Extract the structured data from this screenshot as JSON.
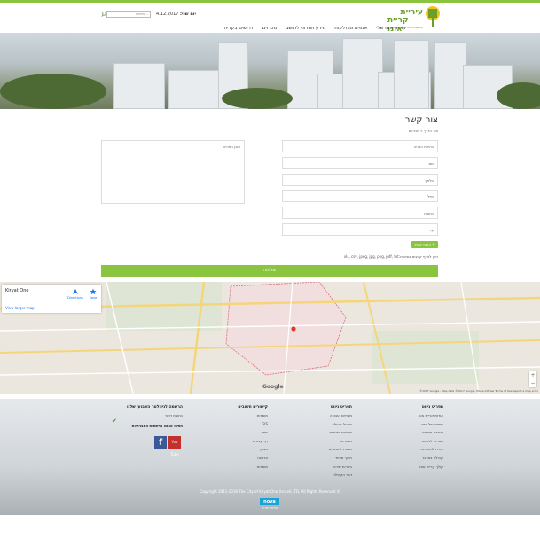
{
  "header": {
    "logo_line1": "עיריית",
    "logo_line2": "קריית אונו",
    "logo_sub": "Kiryat Ono Municipality",
    "date_label": "יום שני:",
    "date_value": "4.12.2017",
    "search_placeholder": "חיפוש..."
  },
  "nav": {
    "items": [
      "קריית אונו שלי",
      "אגפים ומחלקות",
      "מידע ושירות לתושב",
      "מכרזים",
      "דרושים בקריה"
    ]
  },
  "page": {
    "title": "צור קשר",
    "breadcrumb": "צור הדרך » מכרזים"
  },
  "form": {
    "fields": [
      "בחירת הפניה",
      "שם",
      "טלפון",
      "מייל",
      "כתובת",
      "עיר"
    ],
    "message_placeholder": "תוכן הפנייה",
    "attach_label": "הוסף קובץ +",
    "note": "ניתן לצרף קבצים בסיומת:xls, csv, jpeg, jpg, png, pdf, txt",
    "send_label": "שליחה"
  },
  "map": {
    "place_name": "Kiryat Ono",
    "larger_map": "View larger map",
    "directions": "Directions",
    "save": "Save",
    "google": "Google",
    "footer": "©2017 Google - Map data ©2017 Google, Mapa GISrael   Terms of Use   Report a map error",
    "zoom_in": "+",
    "zoom_out": "−"
  },
  "footer": {
    "col1": {
      "title": "תפריט ניווט",
      "items": [
        "אודות קריית אונו",
        "סיפורו של ישוב",
        "נבחרת תפוזים",
        "המרכז לכותים",
        "עזרה למשפחה",
        "קהילה במרכז",
        "קולך קריית אונו"
      ]
    },
    "col2": {
      "title": "תפריט ניווט",
      "items": [
        "מכרזים ועבודה",
        "מינהל קהילה",
        "מכרזים פנימיים",
        "מאגרים",
        "תכנית לחומשים",
        "חינוך מיוחד",
        "בקרות שירות",
        "דבר הקהילה"
      ]
    },
    "col3": {
      "title": "קישורים חשובים",
      "items": [
        "מוסדות",
        "GIS",
        "מפה",
        "דף עבודה",
        "מצפן",
        "ארנונה",
        "מוסדות"
      ]
    },
    "col4": {
      "title": "הרשמה לניוזלטר השבועי שלנו",
      "items": [
        "כתובת דואר",
        "חפשו אותנו ברשתות החברתיות"
      ]
    },
    "facebook": "f",
    "youtube": "You Tube",
    "copyright": "Copyright 2011-2018 The City of Kiryat Ono (Israel) LTD. All Rights Reserved ©",
    "nova": "nova",
    "nova_sub": "בניית אתרים"
  }
}
